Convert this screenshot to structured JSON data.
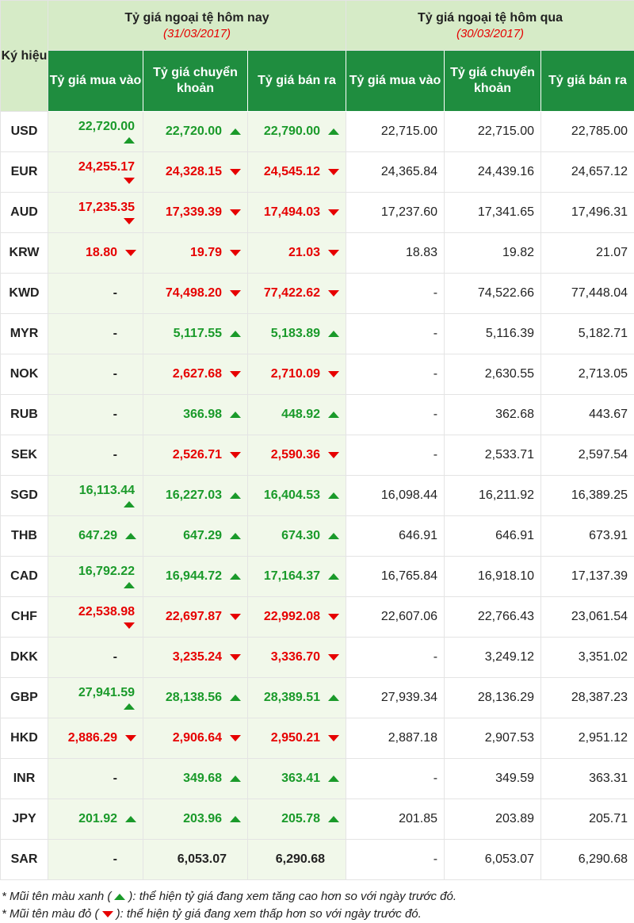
{
  "header": {
    "ky_hieu": "Ký hiệu",
    "today_title": "Tỷ giá ngoại tệ hôm nay",
    "today_date": "(31/03/2017)",
    "yesterday_title": "Tỷ giá ngoại tệ hôm qua",
    "yesterday_date": "(30/03/2017)",
    "col_buy": "Tỷ giá mua vào",
    "col_transfer": "Tỷ giá chuyển khoản",
    "col_sell": "Tỷ giá bán ra"
  },
  "colors": {
    "up": "#1a9a2a",
    "down": "#e60000",
    "header_green": "#1f8d3f",
    "header_light": "#d6ebc7"
  },
  "rows": [
    {
      "code": "USD",
      "buy": "22,720.00",
      "buy_dir": "up",
      "buy_wrap": true,
      "transfer": "22,720.00",
      "transfer_dir": "up",
      "sell": "22,790.00",
      "sell_dir": "up",
      "y_buy": "22,715.00",
      "y_transfer": "22,715.00",
      "y_sell": "22,785.00"
    },
    {
      "code": "EUR",
      "buy": "24,255.17",
      "buy_dir": "down",
      "buy_wrap": true,
      "transfer": "24,328.15",
      "transfer_dir": "down",
      "sell": "24,545.12",
      "sell_dir": "down",
      "y_buy": "24,365.84",
      "y_transfer": "24,439.16",
      "y_sell": "24,657.12"
    },
    {
      "code": "AUD",
      "buy": "17,235.35",
      "buy_dir": "down",
      "buy_wrap": true,
      "transfer": "17,339.39",
      "transfer_dir": "down",
      "sell": "17,494.03",
      "sell_dir": "down",
      "y_buy": "17,237.60",
      "y_transfer": "17,341.65",
      "y_sell": "17,496.31"
    },
    {
      "code": "KRW",
      "buy": "18.80",
      "buy_dir": "down",
      "buy_wrap": false,
      "transfer": "19.79",
      "transfer_dir": "down",
      "sell": "21.03",
      "sell_dir": "down",
      "y_buy": "18.83",
      "y_transfer": "19.82",
      "y_sell": "21.07"
    },
    {
      "code": "KWD",
      "buy": "-",
      "buy_dir": "none",
      "buy_wrap": false,
      "transfer": "74,498.20",
      "transfer_dir": "down",
      "sell": "77,422.62",
      "sell_dir": "down",
      "y_buy": "-",
      "y_transfer": "74,522.66",
      "y_sell": "77,448.04"
    },
    {
      "code": "MYR",
      "buy": "-",
      "buy_dir": "none",
      "buy_wrap": false,
      "transfer": "5,117.55",
      "transfer_dir": "up",
      "sell": "5,183.89",
      "sell_dir": "up",
      "y_buy": "-",
      "y_transfer": "5,116.39",
      "y_sell": "5,182.71"
    },
    {
      "code": "NOK",
      "buy": "-",
      "buy_dir": "none",
      "buy_wrap": false,
      "transfer": "2,627.68",
      "transfer_dir": "down",
      "sell": "2,710.09",
      "sell_dir": "down",
      "y_buy": "-",
      "y_transfer": "2,630.55",
      "y_sell": "2,713.05"
    },
    {
      "code": "RUB",
      "buy": "-",
      "buy_dir": "none",
      "buy_wrap": false,
      "transfer": "366.98",
      "transfer_dir": "up",
      "sell": "448.92",
      "sell_dir": "up",
      "y_buy": "-",
      "y_transfer": "362.68",
      "y_sell": "443.67"
    },
    {
      "code": "SEK",
      "buy": "-",
      "buy_dir": "none",
      "buy_wrap": false,
      "transfer": "2,526.71",
      "transfer_dir": "down",
      "sell": "2,590.36",
      "sell_dir": "down",
      "y_buy": "-",
      "y_transfer": "2,533.71",
      "y_sell": "2,597.54"
    },
    {
      "code": "SGD",
      "buy": "16,113.44",
      "buy_dir": "up",
      "buy_wrap": true,
      "transfer": "16,227.03",
      "transfer_dir": "up",
      "sell": "16,404.53",
      "sell_dir": "up",
      "y_buy": "16,098.44",
      "y_transfer": "16,211.92",
      "y_sell": "16,389.25"
    },
    {
      "code": "THB",
      "buy": "647.29",
      "buy_dir": "up",
      "buy_wrap": false,
      "transfer": "647.29",
      "transfer_dir": "up",
      "sell": "674.30",
      "sell_dir": "up",
      "y_buy": "646.91",
      "y_transfer": "646.91",
      "y_sell": "673.91"
    },
    {
      "code": "CAD",
      "buy": "16,792.22",
      "buy_dir": "up",
      "buy_wrap": true,
      "transfer": "16,944.72",
      "transfer_dir": "up",
      "sell": "17,164.37",
      "sell_dir": "up",
      "y_buy": "16,765.84",
      "y_transfer": "16,918.10",
      "y_sell": "17,137.39"
    },
    {
      "code": "CHF",
      "buy": "22,538.98",
      "buy_dir": "down",
      "buy_wrap": true,
      "transfer": "22,697.87",
      "transfer_dir": "down",
      "sell": "22,992.08",
      "sell_dir": "down",
      "y_buy": "22,607.06",
      "y_transfer": "22,766.43",
      "y_sell": "23,061.54"
    },
    {
      "code": "DKK",
      "buy": "-",
      "buy_dir": "none",
      "buy_wrap": false,
      "transfer": "3,235.24",
      "transfer_dir": "down",
      "sell": "3,336.70",
      "sell_dir": "down",
      "y_buy": "-",
      "y_transfer": "3,249.12",
      "y_sell": "3,351.02"
    },
    {
      "code": "GBP",
      "buy": "27,941.59",
      "buy_dir": "up",
      "buy_wrap": true,
      "transfer": "28,138.56",
      "transfer_dir": "up",
      "sell": "28,389.51",
      "sell_dir": "up",
      "y_buy": "27,939.34",
      "y_transfer": "28,136.29",
      "y_sell": "28,387.23"
    },
    {
      "code": "HKD",
      "buy": "2,886.29",
      "buy_dir": "down",
      "buy_wrap": false,
      "transfer": "2,906.64",
      "transfer_dir": "down",
      "sell": "2,950.21",
      "sell_dir": "down",
      "y_buy": "2,887.18",
      "y_transfer": "2,907.53",
      "y_sell": "2,951.12"
    },
    {
      "code": "INR",
      "buy": "-",
      "buy_dir": "none",
      "buy_wrap": false,
      "transfer": "349.68",
      "transfer_dir": "up",
      "sell": "363.41",
      "sell_dir": "up",
      "y_buy": "-",
      "y_transfer": "349.59",
      "y_sell": "363.31"
    },
    {
      "code": "JPY",
      "buy": "201.92",
      "buy_dir": "up",
      "buy_wrap": false,
      "transfer": "203.96",
      "transfer_dir": "up",
      "sell": "205.78",
      "sell_dir": "up",
      "y_buy": "201.85",
      "y_transfer": "203.89",
      "y_sell": "205.71"
    },
    {
      "code": "SAR",
      "buy": "-",
      "buy_dir": "none",
      "buy_wrap": false,
      "transfer": "6,053.07",
      "transfer_dir": "none",
      "sell": "6,290.68",
      "sell_dir": "none",
      "y_buy": "-",
      "y_transfer": "6,053.07",
      "y_sell": "6,290.68"
    }
  ],
  "footer": {
    "note_up_before": "* Mũi tên màu xanh (",
    "note_up_after": "): thể hiện tỷ giá đang xem tăng cao hơn so với ngày trước đó.",
    "note_down_before": "* Mũi tên màu đỏ (",
    "note_down_after": "): thể hiện tỷ giá đang xem thấp hơn so với ngày trước đó."
  }
}
